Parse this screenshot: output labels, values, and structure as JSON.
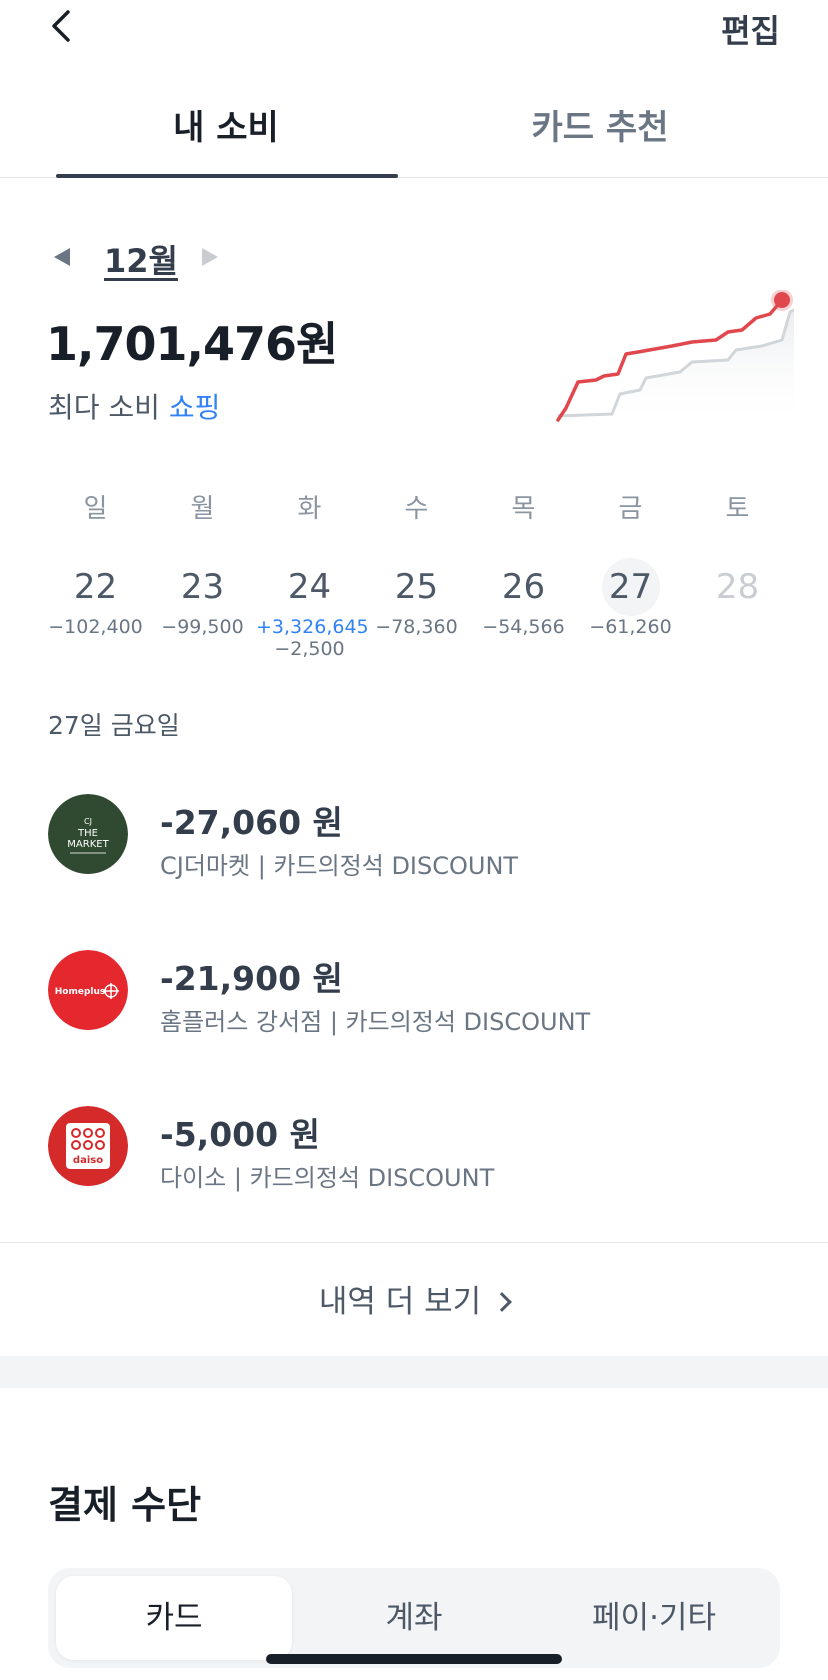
{
  "header": {
    "edit_label": "편집"
  },
  "tabs": [
    {
      "label": "내 소비",
      "active": true
    },
    {
      "label": "카드 추천",
      "active": false
    }
  ],
  "month": {
    "label": "12월"
  },
  "summary": {
    "total": "1,701,476원",
    "max_prefix": "최다 소비",
    "max_category": "쇼핑"
  },
  "week": [
    {
      "dow": "일",
      "date": "22",
      "amounts": [
        "−102,400"
      ]
    },
    {
      "dow": "월",
      "date": "23",
      "amounts": [
        "−99,500"
      ]
    },
    {
      "dow": "화",
      "date": "24",
      "amounts": [
        "+3,326,645",
        "−2,500"
      ]
    },
    {
      "dow": "수",
      "date": "25",
      "amounts": [
        "−78,360"
      ]
    },
    {
      "dow": "목",
      "date": "26",
      "amounts": [
        "−54,566"
      ]
    },
    {
      "dow": "금",
      "date": "27",
      "amounts": [
        "−61,260"
      ],
      "selected": true
    },
    {
      "dow": "토",
      "date": "28",
      "amounts": [],
      "future": true
    }
  ],
  "day_detail": {
    "heading": "27일 금요일",
    "transactions": [
      {
        "amount": "-27,060 원",
        "desc": "CJ더마켓 | 카드의정석 DISCOUNT",
        "logo": "cj-the-market-logo",
        "logo_lines": [
          "CJ",
          "THE",
          "MARKET"
        ],
        "color": "#2f4a30"
      },
      {
        "amount": "-21,900 원",
        "desc": "홈플러스 강서점 | 카드의정석 DISCOUNT",
        "logo": "homeplus-logo",
        "logo_text": "Homeplus",
        "color": "#e5282d"
      },
      {
        "amount": "-5,000 원",
        "desc": "다이소 | 카드의정석 DISCOUNT",
        "logo": "daiso-logo",
        "logo_text": "daiso",
        "color": "#d42a2a"
      }
    ],
    "more_label": "내역 더 보기"
  },
  "payment": {
    "title": "결제 수단",
    "options": [
      {
        "label": "카드",
        "active": true
      },
      {
        "label": "계좌",
        "active": false
      },
      {
        "label": "페이·기타",
        "active": false
      }
    ]
  },
  "colors": {
    "accent_blue": "#3182f6",
    "chart_red": "#e0484e",
    "chart_gray": "#c9cdd2"
  }
}
